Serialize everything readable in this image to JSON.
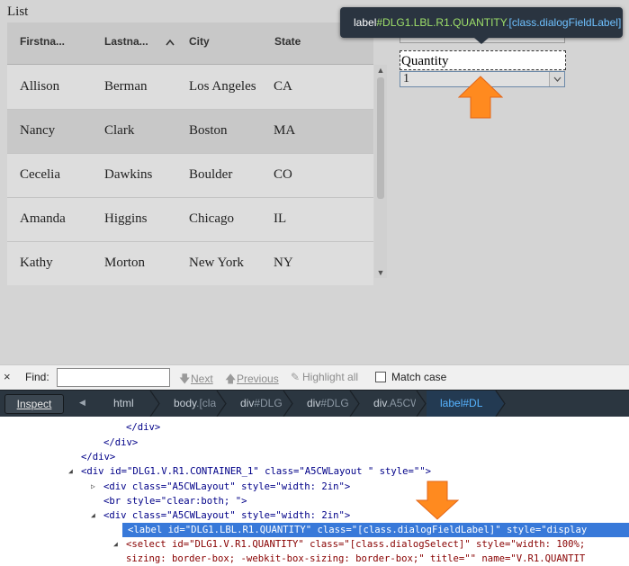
{
  "page": {
    "list_title": "List",
    "columns": [
      "Firstna...",
      "Lastna...",
      "City",
      "State"
    ],
    "rows": [
      [
        "Allison",
        "Berman",
        "Los Angeles",
        "CA"
      ],
      [
        "Nancy",
        "Clark",
        "Boston",
        "MA"
      ],
      [
        "Cecelia",
        "Dawkins",
        "Boulder",
        "CO"
      ],
      [
        "Amanda",
        "Higgins",
        "Chicago",
        "IL"
      ],
      [
        "Kathy",
        "Morton",
        "New York",
        "NY"
      ]
    ],
    "quantity_label": "Quantity",
    "quantity_value": "1"
  },
  "tooltip": {
    "tag": "label",
    "id": "#DLG1.LBL.R1.QUANTITY",
    "class": ".[class.dialogFieldLabel]"
  },
  "findbar": {
    "close": "×",
    "find_label": "Find:",
    "next": "Next",
    "previous": "Previous",
    "highlight_all": "Highlight all",
    "match_case": "Match case",
    "search_value": ""
  },
  "devtools": {
    "inspect_label": "Inspect",
    "breadcrumbs": [
      {
        "tag": "html",
        "rest": ""
      },
      {
        "tag": "body",
        "rest": ".[cla"
      },
      {
        "tag": "div",
        "rest": "#DLG"
      },
      {
        "tag": "div",
        "rest": "#DLG"
      },
      {
        "tag": "div",
        "rest": ".A5CW"
      },
      {
        "tag": "label",
        "rest": "#DL"
      }
    ]
  },
  "markup": {
    "lines": [
      "</div>",
      "</div>",
      "</div>",
      "<div id=\"DLG1.V.R1.CONTAINER_1\" class=\"A5CWLayout \" style=\"\">",
      "<div class=\"A5CWLayout\" style=\"width: 2in\">",
      "<br style=\"clear:both; \">",
      "<div class=\"A5CWLayout\" style=\"width: 2in\">",
      "<label id=\"DLG1.LBL.R1.QUANTITY\" class=\"[class.dialogFieldLabel]\" style=\"display",
      "<select id=\"DLG1.V.R1.QUANTITY\" class=\"[class.dialogSelect]\" style=\"width: 100%;",
      "sizing: border-box; -webkit-box-sizing: border-box;\" title=\"\" name=\"V.R1.QUANTIT"
    ]
  }
}
